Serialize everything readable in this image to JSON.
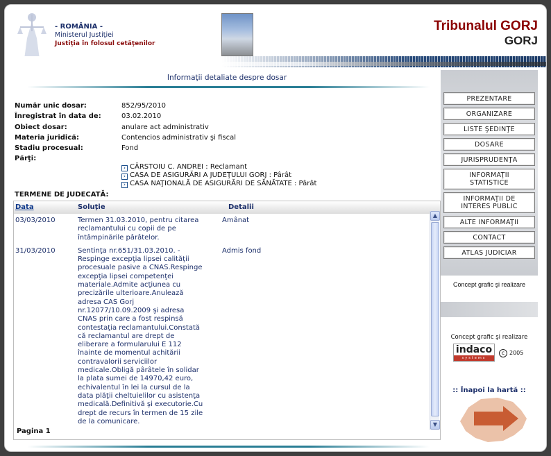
{
  "header": {
    "country": "- ROMÂNIA -",
    "ministry": "Ministerul Justiţiei",
    "motto": "Justiţia în folosul cetăţenilor",
    "court_title": "Tribunalul GORJ",
    "court_subtitle": "GORJ"
  },
  "main": {
    "section_title": "Informaţii detaliate despre dosar",
    "details": [
      {
        "label": "Număr unic dosar:",
        "value": "852/95/2010"
      },
      {
        "label": "Înregistrat în data de:",
        "value": "03.02.2010"
      },
      {
        "label": "Obiect dosar:",
        "value": "anulare act administrativ"
      },
      {
        "label": "Materia juridică:",
        "value": "Contencios administrativ şi fiscal"
      },
      {
        "label": "Stadiu procesual:",
        "value": "Fond"
      },
      {
        "label": "Părţi:",
        "value": ""
      }
    ],
    "parties": [
      "CÂRSTOIU C. ANDREI : Reclamant",
      "CASA DE ASIGURĂRI A JUDEŢULUI GORJ : Pârât",
      "CASA NAŢIONALĂ DE ASIGURĂRI DE SĂNĂTATE : Pârât"
    ],
    "termene_title": "TERMENE DE JUDECATĂ:",
    "table": {
      "headers": {
        "data": "Data",
        "solutie": "Soluţie",
        "detalii": "Detalii"
      },
      "rows": [
        {
          "date": "03/03/2010",
          "solutie_lines": [
            "Termen 31.03.2010, pentru citarea",
            "reclamantului cu copii de pe",
            "întâmpinările pârâtelor."
          ],
          "detalii": "Amânat"
        },
        {
          "date": "31/03/2010",
          "solutie_lines": [
            "Sentinţa nr.651/31.03.2010. -",
            "Respinge excepţia lipsei calităţii",
            "procesuale pasive a CNAS.Respinge",
            "excepţia lipsei competenţei",
            "materiale.Admite acţiunea cu",
            "precizările ulterioare.Anulează",
            "adresa CAS Gorj",
            "nr.12077/10.09.2009 şi adresa",
            "CNAS prin care a fost respinsă",
            "contestaţia reclamantului.Constată",
            "că reclamantul are drept de",
            "eliberare a formularului E 112",
            "înainte de momentul achitării",
            "contravalorii serviciilor",
            "medicale.Obligă pârâtele în solidar",
            "la plata sumei de 14970,42 euro,",
            "echivalentul în lei la cursul de la",
            "data plăţii cheltuielilor cu asistenţa",
            "medicală.Definitivă şi executorie.Cu",
            "drept de recurs în termen de 15 zile",
            "de la comunicare."
          ],
          "detalii": "Admis fond"
        }
      ]
    },
    "pagination": "Pagina 1"
  },
  "sidebar": {
    "nav": [
      "PREZENTARE",
      "ORGANIZARE",
      "LISTE ŞEDINŢE",
      "DOSARE",
      "JURISPRUDENŢA",
      "INFORMAŢII STATISTICE",
      "INFORMAŢII DE INTERES PUBLIC",
      "ALTE INFORMAŢII",
      "CONTACT",
      "ATLAS JUDICIAR"
    ],
    "concept_text_1": "Concept grafic şi realizare",
    "concept_text_2": "Concept grafic şi realizare",
    "vendor_logo": "indaco",
    "vendor_sub": "systems",
    "copyright_year": "2005",
    "copyright_symbol": "c",
    "back_to_map": ":: Înapoi la hartă ::"
  }
}
